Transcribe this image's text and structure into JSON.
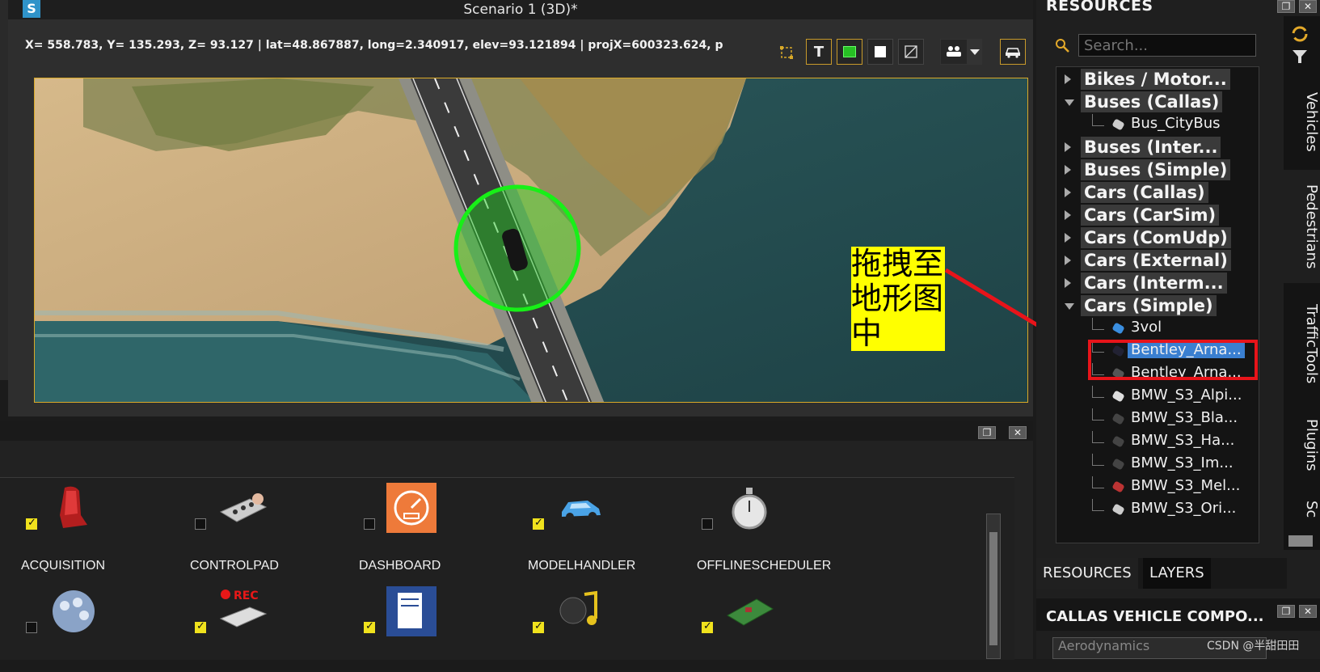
{
  "window": {
    "title": "Scenario 1 (3D)*",
    "logo": "S",
    "coords": "X= 558.783, Y= 135.293, Z=  93.127 | lat=48.867887, long=2.340917, elev=93.121894 | projX=600323.624, p",
    "toolbar": {
      "text_toggle_label": "T",
      "icons": [
        "crop-icon",
        "text-icon",
        "green-square-icon",
        "white-square-icon",
        "diagonal-square-icon",
        "camera-people-icon",
        "dropdown-arrow-icon",
        "vehicle-icon"
      ]
    }
  },
  "annotation": {
    "text": "拖拽至地形图中",
    "color": "#e8141a"
  },
  "plugins": {
    "row1": [
      {
        "label": "ACQUISITION",
        "checked": true,
        "icon": "car-seat-icon"
      },
      {
        "label": "CONTROLPAD",
        "checked": false,
        "icon": "control-pad-icon"
      },
      {
        "label": "DASHBOARD",
        "checked": false,
        "icon": "dashboard-gauge-icon"
      },
      {
        "label": "MODELHANDLER",
        "checked": true,
        "icon": "blue-car-icon"
      },
      {
        "label": "OFFLINESCHEDULER",
        "checked": false,
        "icon": "stopwatch-icon"
      }
    ],
    "row2": [
      {
        "checked": false,
        "icon": "network-globe-icon"
      },
      {
        "checked": true,
        "icon": "rec-device-icon"
      },
      {
        "checked": true,
        "icon": "document-edit-icon"
      },
      {
        "checked": true,
        "icon": "music-note-icon"
      },
      {
        "checked": true,
        "icon": "circuit-board-icon"
      }
    ]
  },
  "resources": {
    "title": "RESOURCES",
    "search_placeholder": "Search...",
    "tree": [
      {
        "label": "Bikes / Motor...",
        "open": false
      },
      {
        "label": "Buses (Callas)",
        "open": true,
        "children": [
          "Bus_CityBus"
        ]
      },
      {
        "label": "Buses (Inter...",
        "open": false
      },
      {
        "label": "Buses (Simple)",
        "open": false
      },
      {
        "label": "Cars (Callas)",
        "open": false
      },
      {
        "label": "Cars (CarSim)",
        "open": false
      },
      {
        "label": "Cars (ComUdp)",
        "open": false
      },
      {
        "label": "Cars (External)",
        "open": false
      },
      {
        "label": "Cars (Interm...",
        "open": false
      },
      {
        "label": "Cars (Simple)",
        "open": true,
        "children": [
          "3vol",
          "Bentley_Arna...",
          "Bentley_Arna...",
          "BMW_S3_Alpi...",
          "BMW_S3_Bla...",
          "BMW_S3_Ha...",
          "BMW_S3_Im...",
          "BMW_S3_Mel...",
          "BMW_S3_Ori..."
        ]
      }
    ],
    "selected_item": "Bentley_Arna...",
    "side_tabs": [
      "Vehicles",
      "Pedestrians",
      "TrafficTools",
      "Plugins",
      "Sc"
    ],
    "bottom_tabs": [
      "RESOURCES",
      "LAYERS"
    ],
    "component_title": "CALLAS VEHICLE COMPO...",
    "component_item": "Aerodynamics"
  },
  "watermark": "CSDN @半甜田田"
}
